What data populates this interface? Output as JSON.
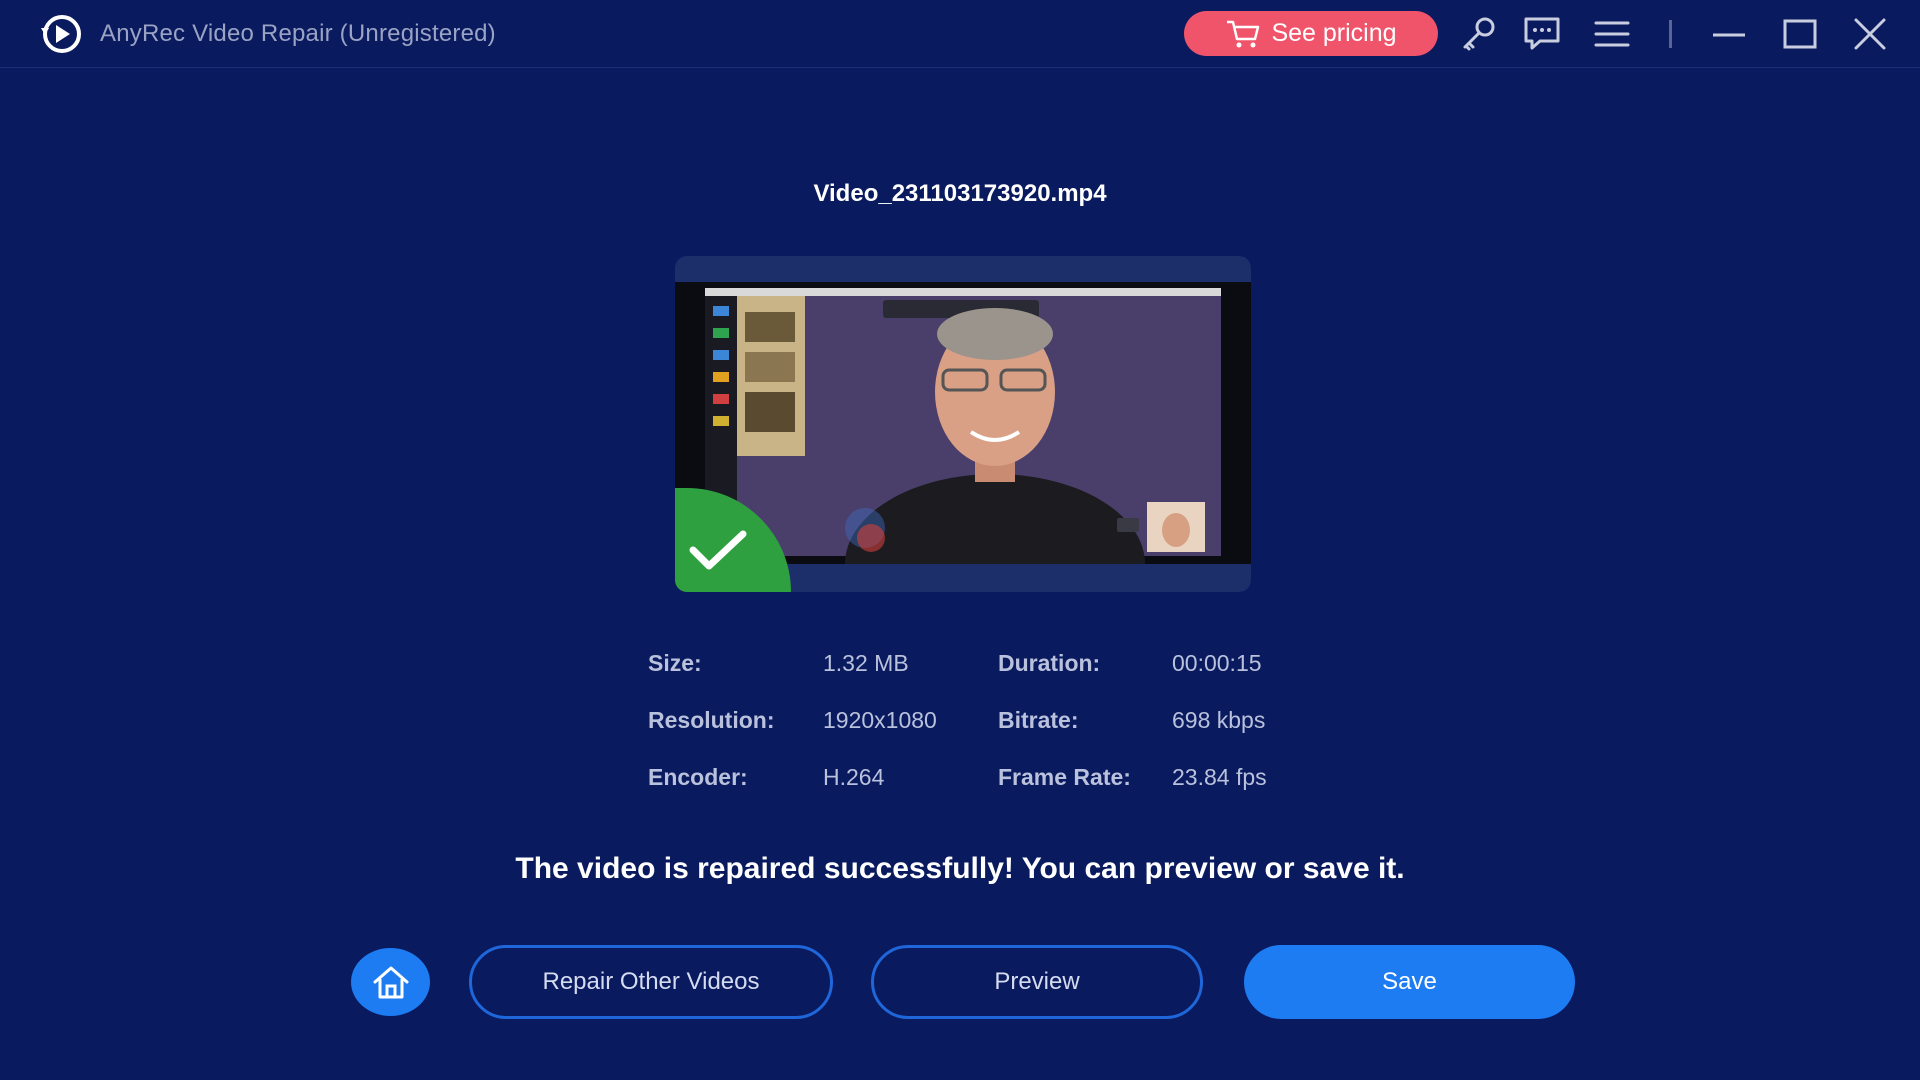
{
  "window": {
    "title": "AnyRec Video Repair (Unregistered)",
    "pricing_label": "See pricing",
    "icons": [
      "app-logo-icon",
      "cart-icon",
      "key-icon",
      "chat-icon",
      "menu-icon",
      "minimize-icon",
      "maximize-icon",
      "close-icon"
    ]
  },
  "main": {
    "filename": "Video_231103173920.mp4",
    "info": {
      "size_label": "Size:",
      "size_value": "1.32 MB",
      "resolution_label": "Resolution:",
      "resolution_value": "1920x1080",
      "encoder_label": "Encoder:",
      "encoder_value": "H.264",
      "duration_label": "Duration:",
      "duration_value": "00:00:15",
      "bitrate_label": "Bitrate:",
      "bitrate_value": "698 kbps",
      "framerate_label": "Frame Rate:",
      "framerate_value": "23.84 fps"
    },
    "success_message": "The video is repaired successfully! You can preview or save it.",
    "buttons": {
      "repair_other": "Repair Other Videos",
      "preview": "Preview",
      "save": "Save"
    }
  },
  "colors": {
    "background": "#0a1a5e",
    "accent": "#1e7cf2",
    "pricing": "#f0546b",
    "success_badge": "#2fa040"
  }
}
